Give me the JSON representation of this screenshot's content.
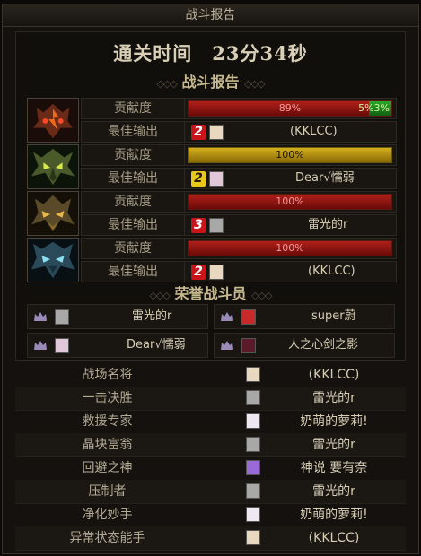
{
  "window": {
    "title": "战斗报告"
  },
  "clear_time": "通关时间　23分34秒",
  "battle_report": {
    "title": "战斗报告",
    "contribution_label": "贡献度",
    "best_output_label": "最佳输出",
    "entries": [
      {
        "class_icon": "fire-demon-icon",
        "contribution": 89,
        "contribution_text": "89%",
        "extra_text": "5%3%",
        "rank": "2",
        "rank_color": "red",
        "best_output_name": "(KKLCC)"
      },
      {
        "class_icon": "green-mantis-icon",
        "contribution": 100,
        "contribution_text": "100%",
        "rank": "2",
        "rank_color": "gold",
        "best_output_name": "Dear√懦弱"
      },
      {
        "class_icon": "gold-beast-icon",
        "contribution": 100,
        "contribution_text": "100%",
        "rank": "3",
        "rank_color": "red",
        "best_output_name": "雷光的r"
      },
      {
        "class_icon": "blue-wolf-icon",
        "contribution": 100,
        "contribution_text": "100%",
        "rank": "2",
        "rank_color": "red",
        "best_output_name": "(KKLCC)"
      }
    ]
  },
  "honor_fighters": {
    "title": "荣誉战斗员",
    "members": [
      "雷光的r",
      "super蔚",
      "Dear√懦弱",
      "人之心剑之影"
    ]
  },
  "awards": [
    {
      "title": "战场名将",
      "name": "(KKLCC)"
    },
    {
      "title": "一击决胜",
      "name": "雷光的r"
    },
    {
      "title": "救援专家",
      "name": "奶萌的萝莉!"
    },
    {
      "title": "晶块富翁",
      "name": "雷光的r"
    },
    {
      "title": "回避之神",
      "name": "神说 要有奈"
    },
    {
      "title": "压制者",
      "name": "雷光的r"
    },
    {
      "title": "净化妙手",
      "name": "奶萌的萝莉!"
    },
    {
      "title": "异常状态能手",
      "name": "(KKLCC)"
    }
  ],
  "colors": {
    "accent_red": "#c8141a",
    "accent_gold": "#e8c81a",
    "bar_red": "#b0201a"
  }
}
